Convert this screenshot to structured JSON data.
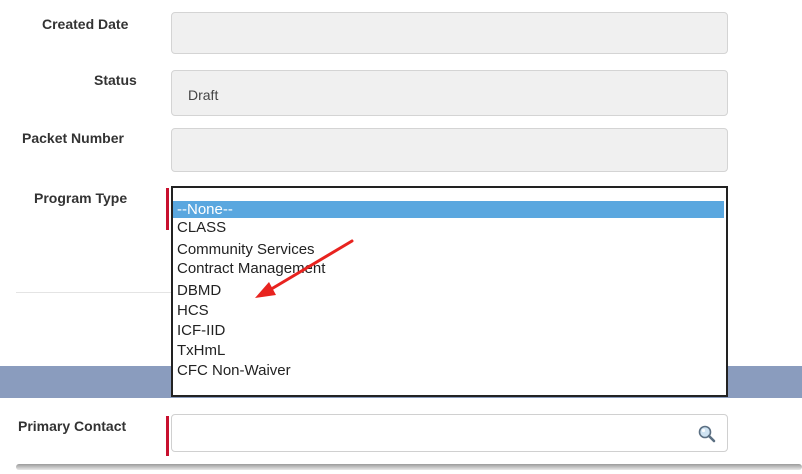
{
  "form": {
    "created_date": {
      "label": "Created Date",
      "value": ""
    },
    "status": {
      "label": "Status",
      "value": "Draft"
    },
    "packet_number": {
      "label": "Packet Number",
      "value": ""
    },
    "program_type": {
      "label": "Program Type",
      "options": [
        "--None--",
        "CLASS",
        "Community Services",
        "Contract Management",
        "DBMD",
        "HCS",
        "ICF-IID",
        "TxHmL",
        "CFC Non-Waiver"
      ],
      "selected_index": 0
    },
    "primary_contact": {
      "label": "Primary Contact",
      "value": ""
    }
  },
  "colors": {
    "required": "#c8102e",
    "selected_option": "#5aa7df",
    "section_band": "#8a9cbe",
    "annotation_arrow": "#e8231f"
  },
  "icons": {
    "lookup": "magnifier-icon"
  }
}
